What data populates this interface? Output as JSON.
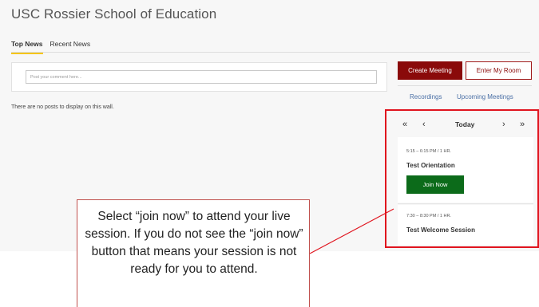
{
  "app": {
    "title": "USC Rossier School of Education"
  },
  "tabs": [
    {
      "label": "Top News",
      "active": true
    },
    {
      "label": "Recent News",
      "active": false
    }
  ],
  "wall": {
    "comment_placeholder": "Post your comment here...",
    "empty_message": "There are no posts to display on this wall."
  },
  "meetings": {
    "create_label": "Create Meeting",
    "enter_label": "Enter My Room",
    "recordings_label": "Recordings",
    "upcoming_label": "Upcoming Meetings"
  },
  "calendar": {
    "first_glyph": "«",
    "prev_glyph": "‹",
    "today_label": "Today",
    "next_glyph": "›",
    "last_glyph": "»",
    "sessions": [
      {
        "time": "5:15 – 6:15 PM / 1 HR.",
        "title": "Test Orientation",
        "join_label": "Join Now"
      },
      {
        "time": "7:30 – 8:30 PM / 1 HR.",
        "title": "Test Welcome Session"
      }
    ]
  },
  "callout": {
    "text": "Select “join now” to attend your live session. If you do not see the “join now” button that means your session is not ready for you to attend."
  },
  "colors": {
    "brand_red": "#8a0a0a",
    "join_green": "#0c6b1a",
    "highlight_red": "#e0141e",
    "tab_underline": "#f5c518",
    "link_blue": "#4a6fa5"
  }
}
